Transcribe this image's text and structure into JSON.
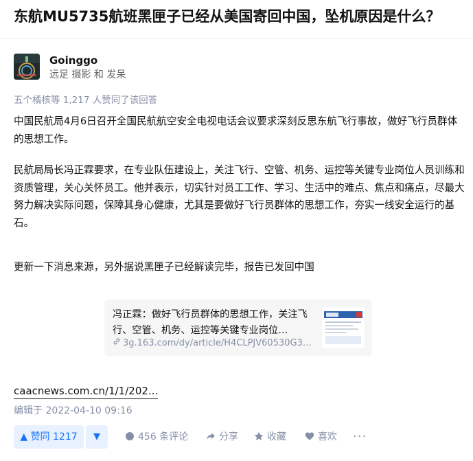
{
  "question": {
    "title": "东航MU5735航班黑匣子已经从美国寄回中国，坠机原因是什么？"
  },
  "author": {
    "name": "Goinggo",
    "bio": "远足 摄影 和 发呆"
  },
  "answer": {
    "voters_text": "五个橘核等 1,217 人赞同了该回答",
    "paragraphs": [
      "中国民航局4月6日召开全国民航航空安全电视电话会议要求深刻反思东航飞行事故，做好飞行员群体的思想工作。",
      "民航局局长冯正霖要求，在专业队伍建设上，关注飞行、空管、机务、运控等关键专业岗位人员训练和资质管理，关心关怀员工。他并表示，切实针对员工工作、学习、生活中的难点、焦点和痛点，尽最大努力解决实际问题，保障其身心健康，尤其是要做好飞行员群体的思想工作，夯实一线安全运行的基石。",
      "更新一下消息来源，另外据说黑匣子已经解读完毕，报告已发回中国"
    ],
    "link_card": {
      "title": "冯正霖：做好飞行员群体的思想工作，关注飞行、空管、机务、运控等关键专业岗位…",
      "url": "3g.163.com/dy/article/H4CLPJV60530G3…",
      "link_icon": "link-icon",
      "thumbnail_icon": "caac-news-thumbnail"
    },
    "source_link": "caacnews.com.cn/1/1/202...",
    "edit_time": "编辑于 2022-04-10 09:16"
  },
  "actions": {
    "vote_up_label": "▲ 赞同 1217",
    "vote_down_label": "▼",
    "comment_label": "456 条评论",
    "share_label": "分享",
    "favorite_label": "收藏",
    "like_label": "喜欢",
    "more_label": "···"
  },
  "colors": {
    "brand_blue": "#1772f6",
    "vote_bg": "#e8f1ff",
    "meta_gray": "#8590a6"
  }
}
